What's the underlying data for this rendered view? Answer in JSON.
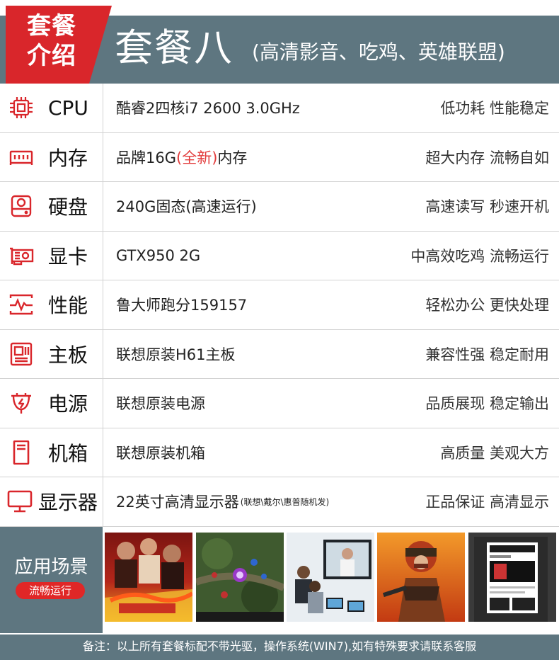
{
  "header": {
    "tag_line1": "套餐",
    "tag_line2": "介绍",
    "title": "套餐八",
    "subtitle": "(高清影音、吃鸡、英雄联盟)"
  },
  "colors": {
    "band": "#5e7680",
    "accent_red": "#d9262b",
    "icon_red": "#d9262b"
  },
  "specs": [
    {
      "icon": "cpu-icon",
      "name": "CPU",
      "value": "酷睿2四核i7 2600  3.0GHz",
      "desc": "低功耗 性能稳定"
    },
    {
      "icon": "memory-icon",
      "name": "内存",
      "value_pre": "品牌16G",
      "value_red": "(全新)",
      "value_post": "内存",
      "desc": "超大内存 流畅自如"
    },
    {
      "icon": "disk-icon",
      "name": "硬盘",
      "value": "240G固态(高速运行)",
      "desc": "高速读写 秒速开机"
    },
    {
      "icon": "gpu-icon",
      "name": "显卡",
      "value": "GTX950 2G",
      "desc": "中高效吃鸡 流畅运行"
    },
    {
      "icon": "performance-icon",
      "name": "性能",
      "value": "鲁大师跑分159157",
      "desc": "轻松办公 更快处理"
    },
    {
      "icon": "motherboard-icon",
      "name": "主板",
      "value": "联想原装H61主板",
      "desc": "兼容性强 稳定耐用"
    },
    {
      "icon": "power-icon",
      "name": "电源",
      "value": "联想原装电源",
      "desc": "品质展现 稳定输出"
    },
    {
      "icon": "case-icon",
      "name": "机箱",
      "value": "联想原装机箱",
      "desc": "高质量 美观大方"
    },
    {
      "icon": "monitor-icon",
      "name": "显示器",
      "value": "22英寸高清显示器",
      "value_small": "(联想\\戴尔\\惠普随机发)",
      "desc": "正品保证 高清显示"
    }
  ],
  "scenes": {
    "title": "应用场景",
    "badge": "流畅运行",
    "images": [
      "movie-poster-image",
      "moba-game-image",
      "video-meeting-image",
      "battle-royale-game-image",
      "photoshop-image"
    ]
  },
  "footer": {
    "note": "备注：以上所有套餐标配不带光驱，操作系统(WIN7),如有特殊要求请联系客服"
  }
}
